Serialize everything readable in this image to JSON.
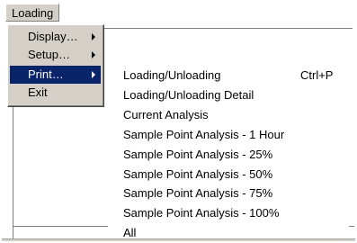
{
  "menubar": {
    "title": "Loading"
  },
  "menu": {
    "items": [
      {
        "label": "Display…",
        "has_submenu": true
      },
      {
        "label": "Setup…",
        "has_submenu": true
      },
      {
        "label": "Print…",
        "has_submenu": true,
        "highlighted": true
      },
      {
        "label": "Exit",
        "has_submenu": false
      }
    ]
  },
  "submenu": {
    "items": [
      {
        "label": "Loading/Unloading",
        "shortcut": "Ctrl+P"
      },
      {
        "label": "Loading/Unloading Detail",
        "shortcut": ""
      },
      {
        "label": "Current Analysis",
        "shortcut": ""
      },
      {
        "label": "Sample Point Analysis - 1 Hour",
        "shortcut": ""
      },
      {
        "label": "Sample Point Analysis - 25%",
        "shortcut": ""
      },
      {
        "label": "Sample Point Analysis - 50%",
        "shortcut": ""
      },
      {
        "label": "Sample Point Analysis - 75%",
        "shortcut": ""
      },
      {
        "label": "Sample Point Analysis - 100%",
        "shortcut": ""
      },
      {
        "label": "All",
        "shortcut": ""
      }
    ]
  },
  "colors": {
    "menu_face": "#d4d0c8",
    "highlight": "#0a246a",
    "highlight_text": "#ffffff"
  },
  "icons": {
    "submenu_arrow": "right-triangle-arrow"
  }
}
